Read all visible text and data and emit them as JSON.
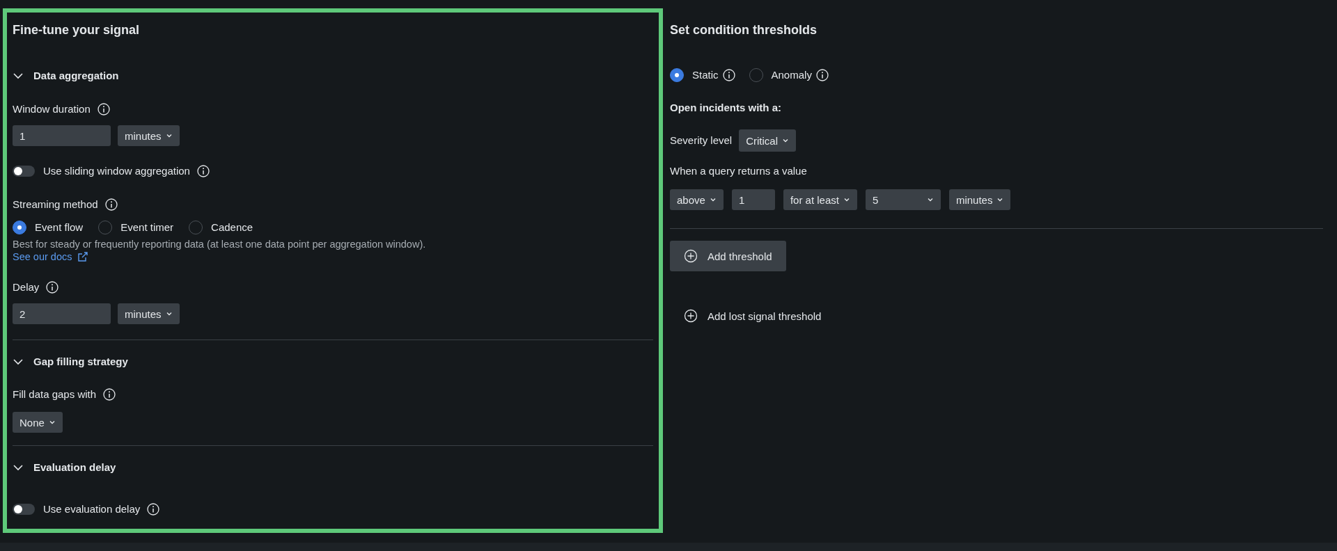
{
  "signal_panel": {
    "title": "Fine-tune your signal",
    "highlighted": true,
    "sections": [
      {
        "title": "Data aggregation",
        "expanded": true,
        "fields": [
          {
            "kind": "duration",
            "label": "Window duration",
            "value": "1",
            "unit": "minutes"
          },
          {
            "kind": "toggle",
            "label": "Use sliding window aggregation",
            "on": false
          },
          {
            "kind": "radios",
            "label": "Streaming method",
            "options": [
              {
                "label": "Event flow",
                "selected": true
              },
              {
                "label": "Event timer",
                "selected": false
              },
              {
                "label": "Cadence",
                "selected": false
              }
            ],
            "help": "Best for steady or frequently reporting data (at least one data point per aggregation window).",
            "link": "See our docs"
          },
          {
            "kind": "duration",
            "label": "Delay",
            "value": "2",
            "unit": "minutes"
          }
        ]
      },
      {
        "title": "Gap filling strategy",
        "expanded": true,
        "fields": [
          {
            "kind": "select",
            "label": "Fill data gaps with",
            "value": "None"
          }
        ]
      },
      {
        "title": "Evaluation delay",
        "expanded": true,
        "fields": [
          {
            "kind": "toggle",
            "label": "Use evaluation delay",
            "on": false
          }
        ]
      }
    ]
  },
  "threshold_panel": {
    "title": "Set condition thresholds",
    "modes": [
      {
        "label": "Static",
        "selected": true
      },
      {
        "label": "Anomaly",
        "selected": false
      }
    ],
    "subtitle": "Open incidents with a:",
    "severity": {
      "label": "Severity level",
      "value": "Critical"
    },
    "condition": {
      "label": "When a query returns a value",
      "controls": [
        {
          "kind": "select",
          "value": "above"
        },
        {
          "kind": "input",
          "value": "1"
        },
        {
          "kind": "select",
          "value": "for at least"
        },
        {
          "kind": "wide-select",
          "value": "5"
        },
        {
          "kind": "select",
          "value": "minutes"
        }
      ]
    },
    "add_threshold": "Add threshold",
    "add_lost_signal": "Add lost signal threshold"
  }
}
